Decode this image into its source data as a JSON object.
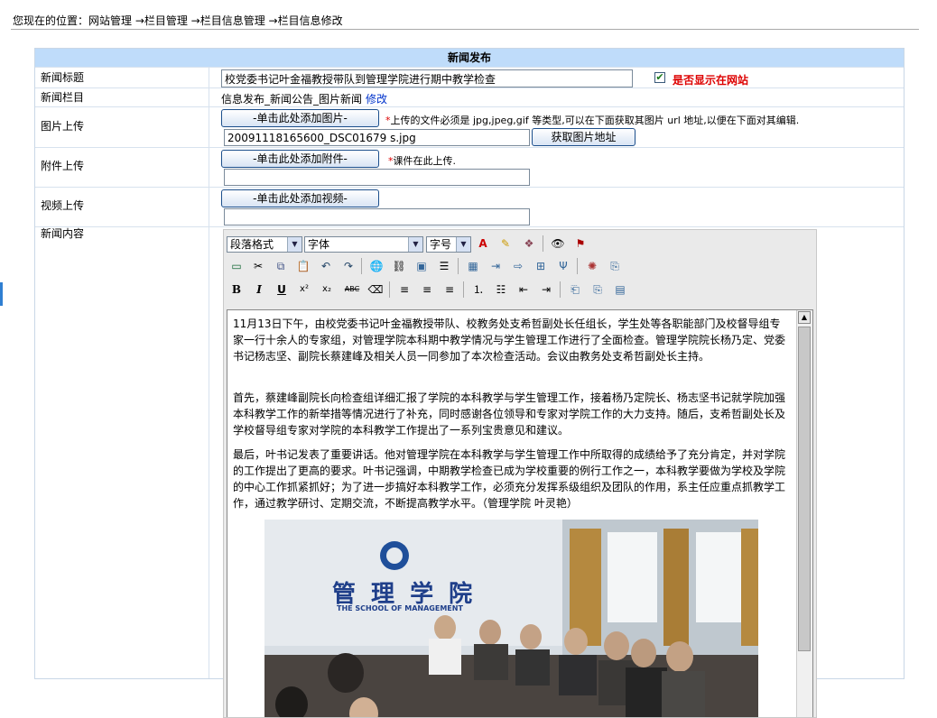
{
  "breadcrumb": "您现在的位置：网站管理 →栏目管理 →栏目信息管理 →栏目信息修改",
  "form": {
    "title": "新闻发布",
    "news_title_label": "新闻标题",
    "news_title_value": "校党委书记叶金福教授带队到管理学院进行期中教学检查",
    "show_on_site_label": "是否显示在网站",
    "column_label": "新闻栏目",
    "column_value": "信息发布_新闻公告_图片新闻",
    "column_edit": "修改",
    "image_label": "图片上传",
    "image_add_button": "-单击此处添加图片-",
    "image_note": "上传的文件必须是 jpg,jpeg,gif 等类型,可以在下面获取其图片 url 地址,以便在下面对其编辑.",
    "image_filename": "20091118165600_DSC01679 s.jpg",
    "get_url_button": "获取图片地址",
    "attach_label": "附件上传",
    "attach_add_button": "-单击此处添加附件-",
    "attach_note": "课件在此上传.",
    "video_label": "视频上传",
    "video_add_button": "-单击此处添加视频-",
    "content_label": "新闻内容"
  },
  "editor": {
    "paragraph_format": "段落格式",
    "font": "字体",
    "font_size": "字号",
    "paragraphs": [
      "11月13日下午，由校党委书记叶金福教授带队、校教务处支希哲副处长任组长，学生处等各职能部门及校督导组专家一行十余人的专家组，对管理学院本科期中教学情况与学生管理工作进行了全面检查。管理学院院长杨乃定、党委书记杨志坚、副院长蔡建峰及相关人员一同参加了本次检查活动。会议由教务处支希哲副处长主持。",
      "首先，蔡建峰副院长向检查组详细汇报了学院的本科教学与学生管理工作，接着杨乃定院长、杨志坚书记就学院加强本科教学工作的新举措等情况进行了补充，同时感谢各位领导和专家对学院工作的大力支持。随后，支希哲副处长及学校督导组专家对学院的本科教学工作提出了一系列宝贵意见和建议。",
      "最后，叶书记发表了重要讲话。他对管理学院在本科教学与学生管理工作中所取得的成绩给予了充分肯定，并对学院的工作提出了更高的要求。叶书记强调，中期教学检查已成为学校重要的例行工作之一，本科教学要做为学校及学院的中心工作抓紧抓好；为了进一步搞好本科教学工作，必须充分发挥系级组织及团队的作用，系主任应重点抓教学工作，通过教学研讨、定期交流，不断提高教学水平。（管理学院 叶灵艳）"
    ],
    "photo_sign_cn": "管 理 学 院",
    "photo_sign_en": "THE SCHOOL OF MANAGEMENT"
  },
  "colors": {
    "header_bg": "#bfdcfa",
    "required_star": "#dd0000",
    "show_label": "#dd0000",
    "link": "#0033cc"
  }
}
